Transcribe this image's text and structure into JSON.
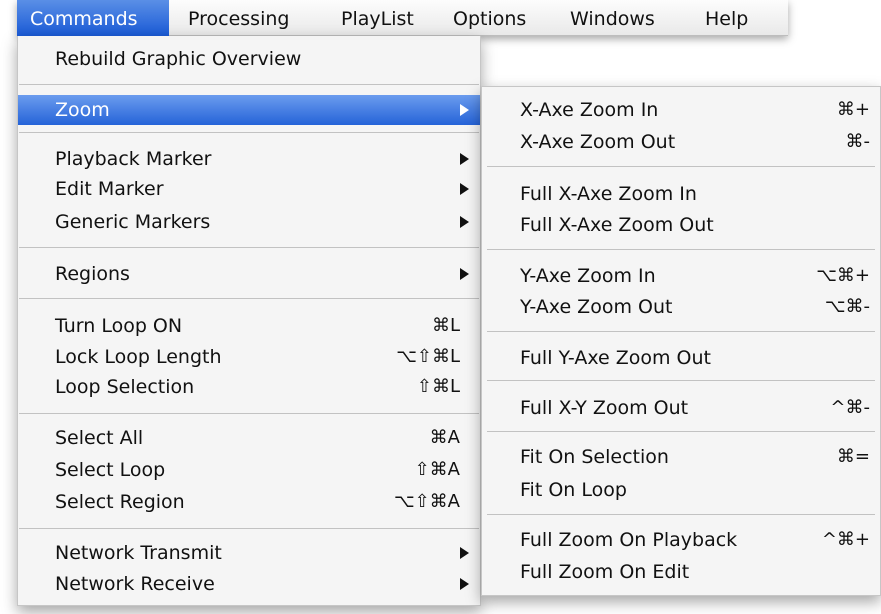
{
  "menubar": {
    "items": [
      {
        "label": "Commands",
        "active": true
      },
      {
        "label": "Processing"
      },
      {
        "label": "PlayList"
      },
      {
        "label": "Options"
      },
      {
        "label": "Windows"
      },
      {
        "label": "Help"
      }
    ]
  },
  "commands_menu": {
    "items": [
      {
        "label": "Rebuild Graphic Overview"
      },
      {
        "label": "Zoom",
        "submenu": true,
        "highlighted": true
      },
      {
        "label": "Playback Marker",
        "submenu": true
      },
      {
        "label": "Edit Marker",
        "submenu": true
      },
      {
        "label": "Generic Markers",
        "submenu": true
      },
      {
        "label": "Regions",
        "submenu": true
      },
      {
        "label": "Turn Loop ON",
        "shortcut": "⌘L"
      },
      {
        "label": "Lock Loop Length",
        "shortcut": "⌥⇧⌘L"
      },
      {
        "label": "Loop Selection",
        "shortcut": "⇧⌘L"
      },
      {
        "label": "Select All",
        "shortcut": "⌘A"
      },
      {
        "label": "Select Loop",
        "shortcut": "⇧⌘A"
      },
      {
        "label": "Select Region",
        "shortcut": "⌥⇧⌘A"
      },
      {
        "label": "Network Transmit",
        "submenu": true
      },
      {
        "label": "Network Receive",
        "submenu": true
      }
    ]
  },
  "zoom_submenu": {
    "items": [
      {
        "label": "X-Axe Zoom In",
        "shortcut": "⌘+"
      },
      {
        "label": "X-Axe Zoom Out",
        "shortcut": "⌘-"
      },
      {
        "label": "Full X-Axe Zoom In"
      },
      {
        "label": "Full X-Axe Zoom Out"
      },
      {
        "label": "Y-Axe Zoom In",
        "shortcut": "⌥⌘+"
      },
      {
        "label": "Y-Axe Zoom Out",
        "shortcut": "⌥⌘-"
      },
      {
        "label": "Full Y-Axe Zoom Out"
      },
      {
        "label": "Full X-Y Zoom Out",
        "shortcut": "^⌘-"
      },
      {
        "label": "Fit On Selection",
        "shortcut": "⌘="
      },
      {
        "label": "Fit On Loop"
      },
      {
        "label": "Full Zoom On Playback",
        "shortcut": "^⌘+"
      },
      {
        "label": "Full Zoom On Edit"
      }
    ]
  },
  "colors": {
    "highlight": "#2563d8",
    "menu_background": "#f5f5f5"
  }
}
